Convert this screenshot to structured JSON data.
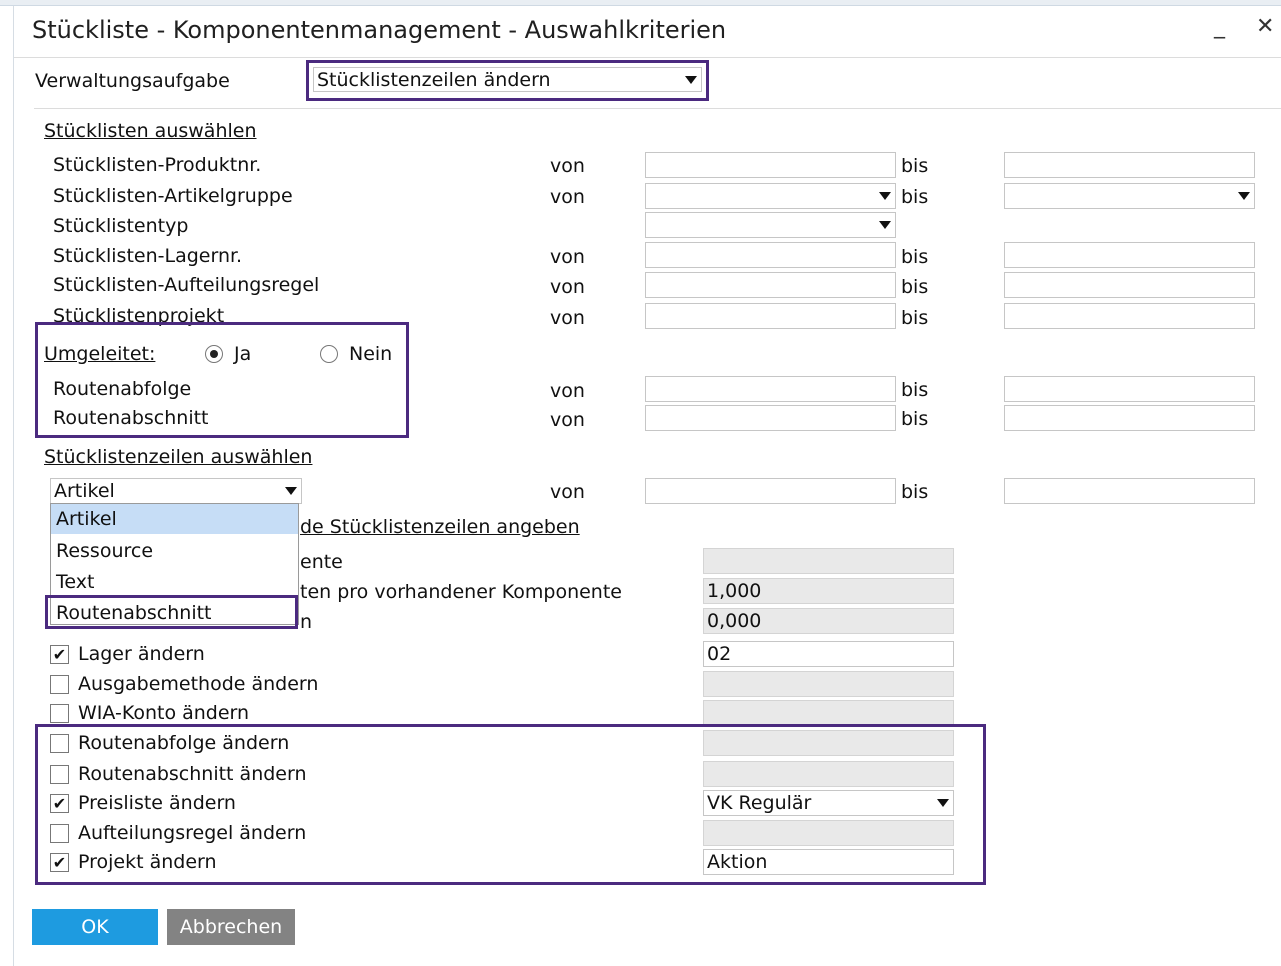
{
  "window": {
    "title": "Stückliste - Komponentenmanagement - Auswahlkriterien"
  },
  "task": {
    "label": "Verwaltungsaufgabe",
    "value": "Stücklistenzeilen ändern"
  },
  "section_bom": {
    "heading": "Stücklisten auswählen",
    "von": "von",
    "bis": "bis",
    "rows": [
      {
        "label": "Stücklisten-Produktnr."
      },
      {
        "label": "Stücklisten-Artikelgruppe"
      },
      {
        "label": "Stücklistentyp"
      },
      {
        "label": "Stücklisten-Lagernr."
      },
      {
        "label": "Stücklisten-Aufteilungsregel"
      },
      {
        "label": "Stücklistenprojekt"
      }
    ]
  },
  "routed": {
    "label": "Umgeleitet:",
    "yes_label": "Ja",
    "no_label": "Nein",
    "selected": "Ja",
    "rows": [
      {
        "label": "Routenabfolge"
      },
      {
        "label": "Routenabschnitt"
      }
    ]
  },
  "section_lines": {
    "heading": "Stücklistenzeilen auswählen",
    "type_value": "Artikel",
    "von": "von",
    "bis": "bis"
  },
  "section_changes": {
    "heading_visible": "de Stücklistenzeilen angeben",
    "partial_labels": {
      "row1": "ente",
      "row2": "ten pro vorhandener Komponente",
      "row3": "n"
    },
    "values": {
      "row1": "",
      "row2": "1,000",
      "row3": "0,000"
    }
  },
  "dropdown": {
    "options": [
      "Artikel",
      "Ressource",
      "Text",
      "Routenabschnitt"
    ],
    "highlighted": "Artikel"
  },
  "checkboxes": [
    {
      "label": "Lager ändern",
      "checked": true,
      "value": "02",
      "enabled": true
    },
    {
      "label": "Ausgabemethode ändern",
      "checked": false,
      "value": "",
      "enabled": false
    },
    {
      "label": "WIA-Konto ändern",
      "checked": false,
      "value": "",
      "enabled": false
    },
    {
      "label": "Routenabfolge ändern",
      "checked": false,
      "value": "",
      "enabled": false
    },
    {
      "label": "Routenabschnitt ändern",
      "checked": false,
      "value": "",
      "enabled": false
    },
    {
      "label": "Preisliste ändern",
      "checked": true,
      "value": "VK Regulär",
      "enabled": true
    },
    {
      "label": "Aufteilungsregel ändern",
      "checked": false,
      "value": "",
      "enabled": false
    },
    {
      "label": "Projekt ändern",
      "checked": true,
      "value": "Aktion",
      "enabled": true
    }
  ],
  "buttons": {
    "ok": "OK",
    "cancel": "Abbrechen"
  },
  "colors": {
    "ok_bg": "#1e9be0",
    "cancel_bg": "#838383",
    "highlight_frame": "#4b2a7f",
    "list_highlight": "#c6ddf6"
  }
}
